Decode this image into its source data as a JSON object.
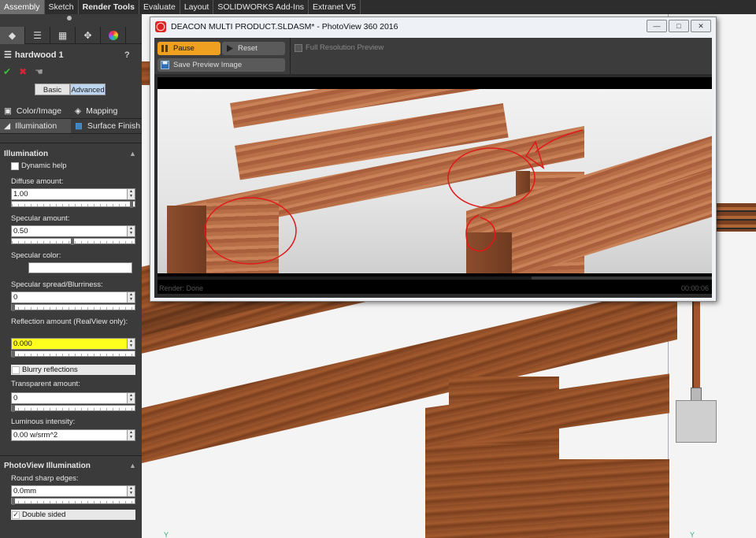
{
  "tabs": [
    {
      "label": "Assembly",
      "active": true
    },
    {
      "label": "Sketch"
    },
    {
      "label": "Render Tools",
      "bold": true
    },
    {
      "label": "Evaluate"
    },
    {
      "label": "Layout"
    },
    {
      "label": "SOLIDWORKS Add-Ins"
    },
    {
      "label": "Extranet V5"
    }
  ],
  "panel": {
    "title": "hardwood 1",
    "help": "?",
    "mode_basic": "Basic",
    "mode_advanced": "Advanced",
    "subtabs": {
      "color_image": "Color/Image",
      "mapping": "Mapping",
      "illumination": "Illumination",
      "surface_finish": "Surface Finish"
    },
    "illumination": {
      "section_title": "Illumination",
      "dynamic_help": "Dynamic help",
      "diffuse_label": "Diffuse amount:",
      "diffuse_value": "1.00",
      "diffuse_level": 1.0,
      "specular_label": "Specular amount:",
      "specular_value": "0.50",
      "specular_level": 0.5,
      "specular_color_label": "Specular color:",
      "spread_label": "Specular spread/Blurriness:",
      "spread_value": "0",
      "spread_level": 0,
      "reflection_label": "Reflection amount (RealView only):",
      "reflection_value": "0.000",
      "reflection_level": 0,
      "blurry_label": "Blurry reflections",
      "transparent_label": "Transparent amount:",
      "transparent_value": "0",
      "transparent_level": 0,
      "luminous_label": "Luminous intensity:",
      "luminous_value": "0.00 w/srm^2"
    },
    "photoview": {
      "section_title": "PhotoView Illumination",
      "round_label": "Round sharp edges:",
      "round_value": "0.0mm",
      "round_level": 0,
      "double_sided_label": "Double sided"
    }
  },
  "photoview_window": {
    "title": "DEACON MULTI PRODUCT.SLDASM* - PhotoView 360 2016",
    "pause_label": "Pause",
    "reset_label": "Reset",
    "save_label": "Save Preview Image",
    "full_res_label": "Full Resolution Preview",
    "status_left": "Render: Done",
    "status_right": "00:00:06",
    "progress": 0.675
  },
  "viewport": {
    "axis_left": "Y",
    "axis_right": "Y"
  },
  "colors": {
    "accent_pause": "#f0a020",
    "highlight_field": "#ffff1e",
    "annotation_red": "#e01818"
  }
}
